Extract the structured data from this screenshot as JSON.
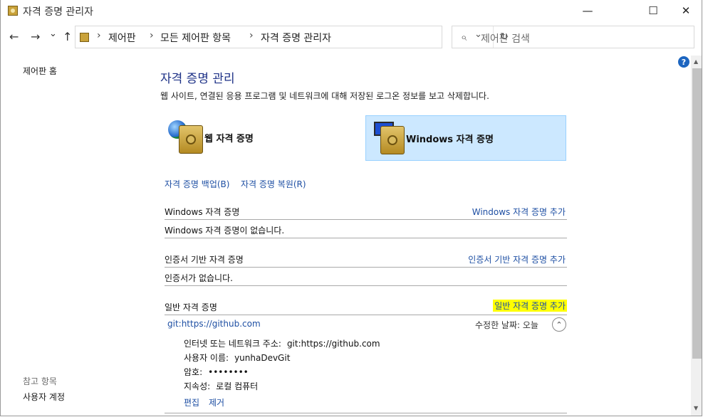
{
  "window": {
    "title": "자격 증명 관리자",
    "minimize": "—",
    "maximize": "☐",
    "close": "✕"
  },
  "nav": {
    "back": "←",
    "forward": "→",
    "history": "⌄",
    "up": "↑",
    "breadcrumbs": [
      "제어판",
      "모든 제어판 항목",
      "자격 증명 관리자"
    ],
    "sep": "›",
    "dropdown": "⌄",
    "refresh": "↻",
    "search_placeholder": "제어판 검색"
  },
  "sidebar": {
    "home": "제어판 홈",
    "see_also": "참고 항목",
    "user_accounts": "사용자 계정"
  },
  "help": "?",
  "main": {
    "heading": "자격 증명 관리",
    "description": "웹 사이트, 연결된 응용 프로그램 및 네트워크에 대해 저장된 로그온 정보를 보고 삭제합니다.",
    "tiles": {
      "web": "웹 자격 증명",
      "windows": "Windows 자격 증명"
    },
    "backup": "자격 증명 백업(B)",
    "restore": "자격 증명 복원(R)",
    "sections": [
      {
        "title": "Windows 자격 증명",
        "add": "Windows 자격 증명 추가",
        "empty": "Windows 자격 증명이 없습니다."
      },
      {
        "title": "인증서 기반 자격 증명",
        "add": "인증서 기반 자격 증명 추가",
        "empty": "인증서가 없습니다."
      },
      {
        "title": "일반 자격 증명",
        "add": "일반 자격 증명 추가"
      }
    ],
    "credential": {
      "name": "git:https://github.com",
      "modified": "수정한 날짜:  오늘",
      "collapse": "⌃",
      "address_label": "인터넷 또는 네트워크 주소:",
      "address": "git:https://github.com",
      "user_label": "사용자 이름:",
      "user": "yunhaDevGit",
      "password_label": "암호:",
      "password": "••••••••",
      "persistence_label": "지속성:",
      "persistence": "로컬 컴퓨터",
      "edit": "편집",
      "remove": "제거"
    }
  },
  "colors": {
    "link": "#1e4fa3",
    "heading": "#1e3287",
    "tile_selected": "#cce8ff",
    "highlight": "#ffff00"
  }
}
